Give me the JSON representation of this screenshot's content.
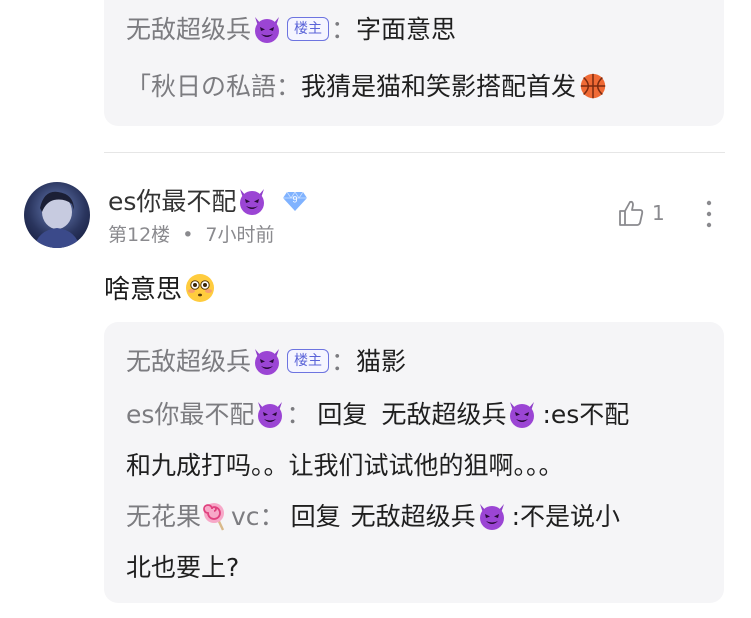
{
  "reply_block_1": {
    "line1": {
      "user": "无敌超级兵",
      "badge": "楼主",
      "sep": "：",
      "text": "字面意思"
    },
    "line2": {
      "user": "「秋日の私語",
      "sep": "：",
      "text": "我猜是猫和笑影搭配首发"
    }
  },
  "comment": {
    "author": "es你最不配",
    "level": "9",
    "floor": "第12楼",
    "dot": "•",
    "time": "7小时前",
    "likes": "1",
    "text": "啥意思"
  },
  "reply_block_2": {
    "r1": {
      "user": "无敌超级兵",
      "badge": "楼主",
      "sep": "：",
      "text": "猫影"
    },
    "r2": {
      "user": "es你最不配",
      "sep": "：",
      "reply_word": "回复",
      "target": "无敌超级兵",
      "text_a": ":es不配",
      "text_b": "和九成打吗。。让我们试试他的狙啊。。。"
    },
    "r3": {
      "user": "无花果",
      "user_suffix": "vc",
      "sep": "：",
      "reply_word": "回复",
      "target": "无敌超级兵",
      "text_a": ":不是说小",
      "text_b": "北也要上?"
    }
  },
  "icons": [
    "devil-emoji-icon",
    "basketball-emoji-icon",
    "flushed-emoji-icon",
    "lollipop-emoji-icon",
    "level-diamond-icon",
    "thumbs-up-icon",
    "more-vertical-icon"
  ],
  "colors": {
    "box": "#f5f5f7",
    "username": "#7c7c80",
    "badge": "#5a63d8",
    "devil": "#8e3ec9"
  }
}
